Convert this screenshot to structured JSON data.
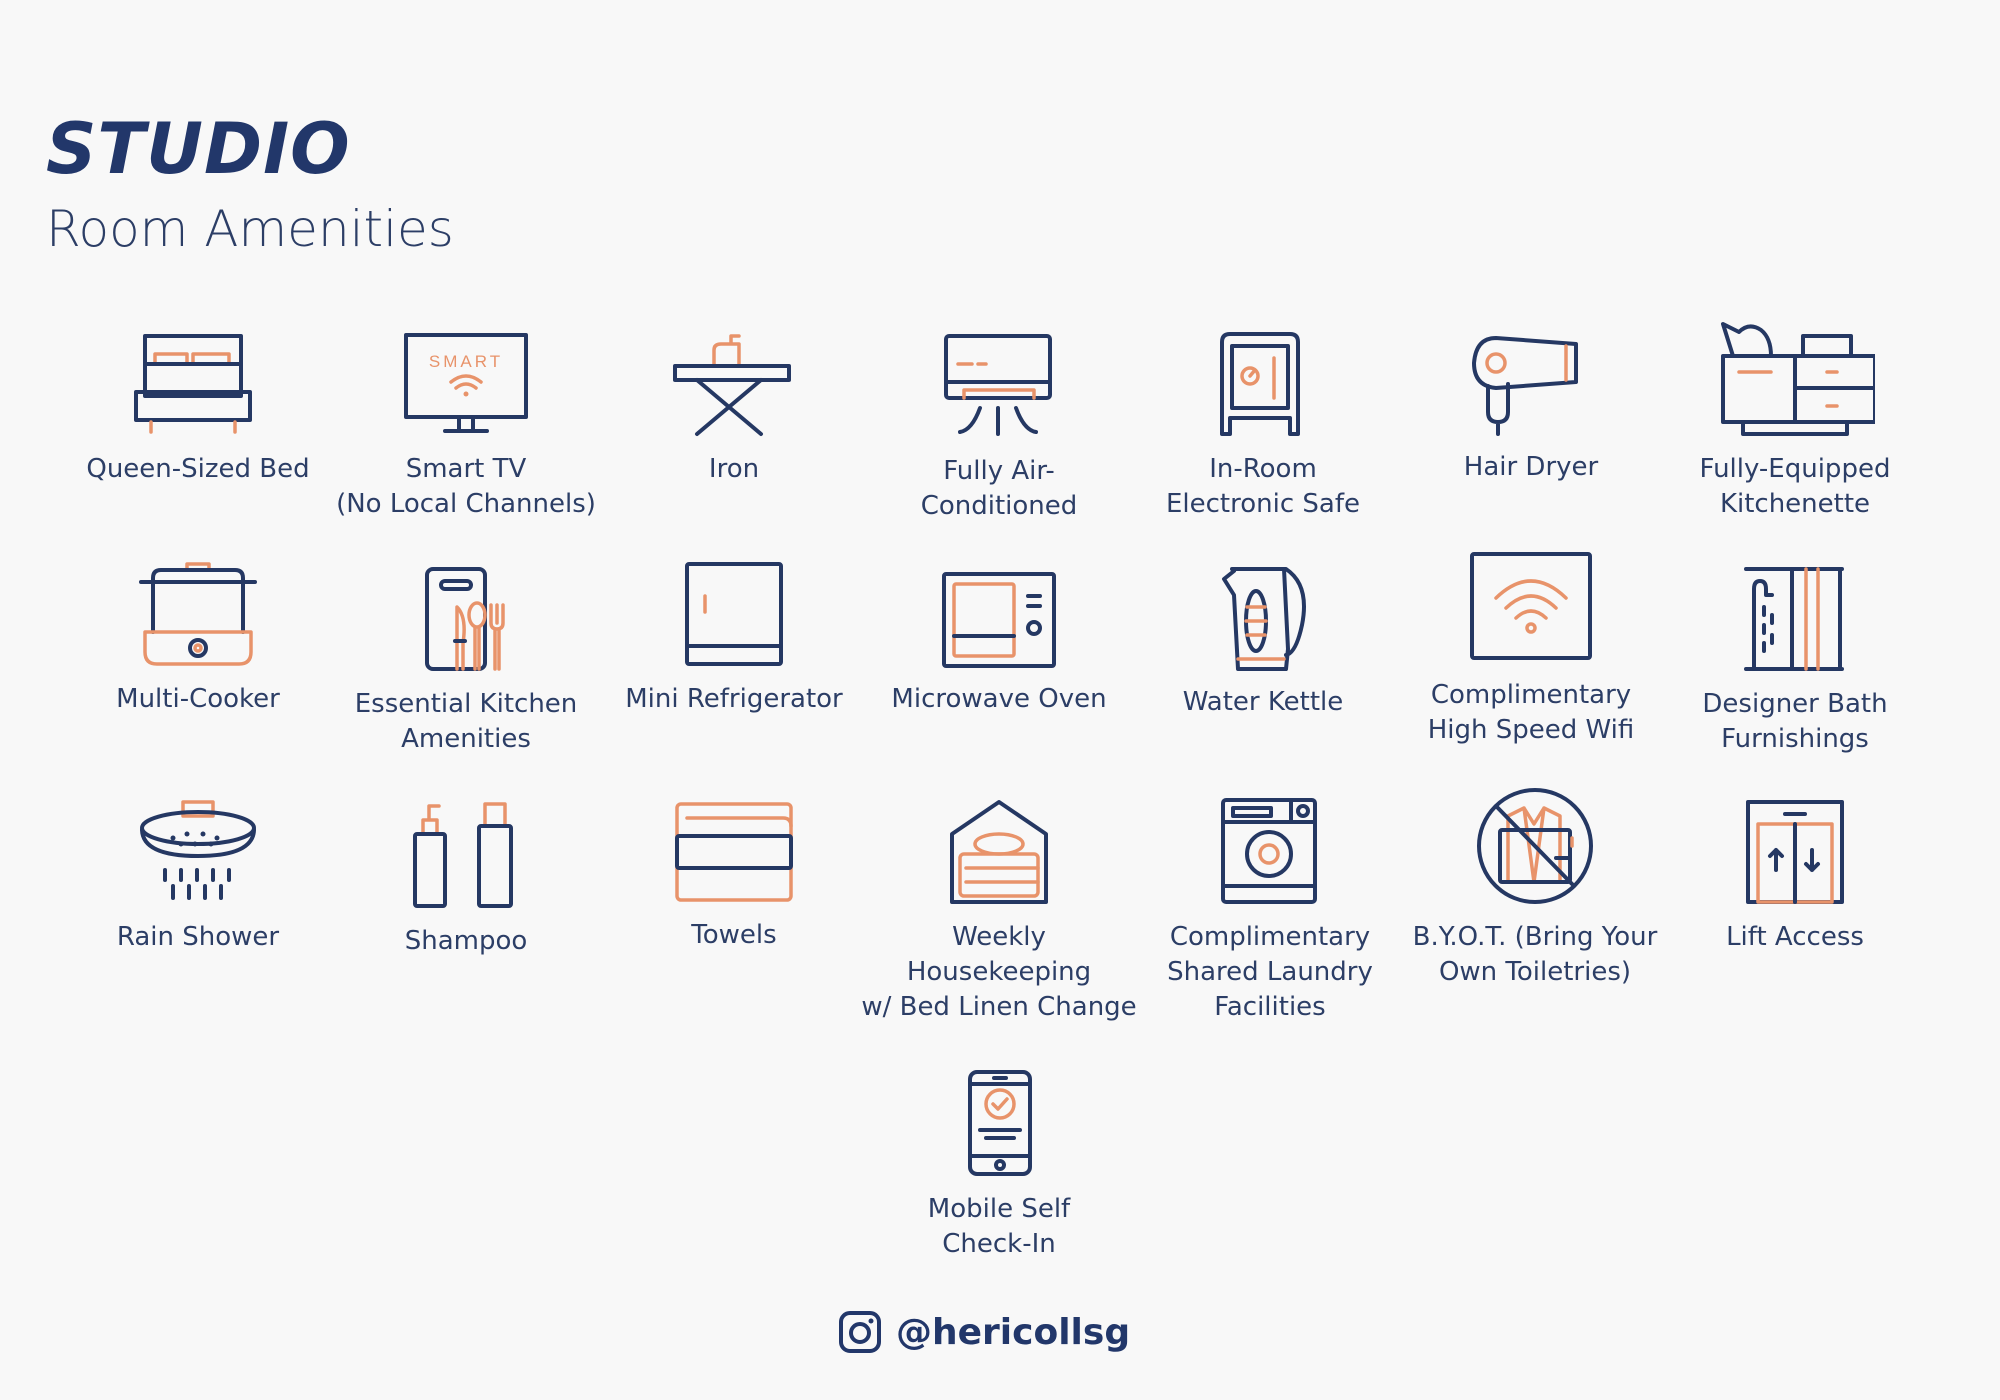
{
  "header": {
    "title": "STUDIO",
    "subtitle": "Room Amenities"
  },
  "colors": {
    "navy": "#253863",
    "accent": "#e8936a",
    "background": "#f8f8f8"
  },
  "amenities": [
    {
      "icon": "bed-icon",
      "label": "Queen-Sized Bed"
    },
    {
      "icon": "smart-tv-icon",
      "label": "Smart TV (No Local Channels)",
      "icon_text": "SMART"
    },
    {
      "icon": "iron-icon",
      "label": "Iron"
    },
    {
      "icon": "air-conditioner-icon",
      "label": "Fully Air-Conditioned"
    },
    {
      "icon": "safe-icon",
      "label": "In-Room Electronic Safe"
    },
    {
      "icon": "hair-dryer-icon",
      "label": "Hair Dryer"
    },
    {
      "icon": "kitchenette-icon",
      "label": "Fully-Equipped Kitchenette"
    },
    {
      "icon": "multi-cooker-icon",
      "label": "Multi-Cooker"
    },
    {
      "icon": "kitchen-utensils-icon",
      "label": "Essential Kitchen Amenities"
    },
    {
      "icon": "mini-fridge-icon",
      "label": "Mini Refrigerator"
    },
    {
      "icon": "microwave-icon",
      "label": "Microwave Oven"
    },
    {
      "icon": "kettle-icon",
      "label": "Water Kettle"
    },
    {
      "icon": "wifi-icon",
      "label": "Complimentary High Speed Wifi"
    },
    {
      "icon": "bath-icon",
      "label": "Designer Bath Furnishings"
    },
    {
      "icon": "rain-shower-icon",
      "label": "Rain Shower"
    },
    {
      "icon": "shampoo-icon",
      "label": "Shampoo"
    },
    {
      "icon": "towels-icon",
      "label": "Towels"
    },
    {
      "icon": "housekeeping-icon",
      "label": "Weekly Housekeeping w/ Bed Linen Change"
    },
    {
      "icon": "washing-machine-icon",
      "label": "Complimentary Shared Laundry Facilities"
    },
    {
      "icon": "no-toiletries-icon",
      "label": "B.Y.O.T. (Bring Your Own Toiletries)"
    },
    {
      "icon": "lift-icon",
      "label": "Lift Access"
    },
    {
      "icon": "mobile-checkin-icon",
      "label": "Mobile Self Check-In"
    }
  ],
  "labels_lines": [
    [
      "Queen-Sized Bed"
    ],
    [
      "Smart TV",
      "(No Local Channels)"
    ],
    [
      "Iron"
    ],
    [
      "Fully Air-",
      "Conditioned"
    ],
    [
      "In-Room",
      "Electronic Safe"
    ],
    [
      "Hair Dryer"
    ],
    [
      "Fully-Equipped",
      "Kitchenette"
    ],
    [
      "Multi-Cooker"
    ],
    [
      "Essential Kitchen",
      "Amenities"
    ],
    [
      "Mini Refrigerator"
    ],
    [
      "Microwave Oven"
    ],
    [
      "Water Kettle"
    ],
    [
      "Complimentary",
      "High Speed Wifi"
    ],
    [
      "Designer Bath",
      "Furnishings"
    ],
    [
      "Rain Shower"
    ],
    [
      "Shampoo"
    ],
    [
      "Towels"
    ],
    [
      "Weekly Housekeeping",
      "w/ Bed Linen Change"
    ],
    [
      "Complimentary",
      "Shared Laundry",
      "Facilities"
    ],
    [
      "B.Y.O.T. (Bring Your",
      "Own Toiletries)"
    ],
    [
      "Lift Access"
    ],
    [
      "Mobile Self",
      "Check-In"
    ]
  ],
  "footer": {
    "icon": "instagram-icon",
    "handle": "@hericollsg"
  }
}
